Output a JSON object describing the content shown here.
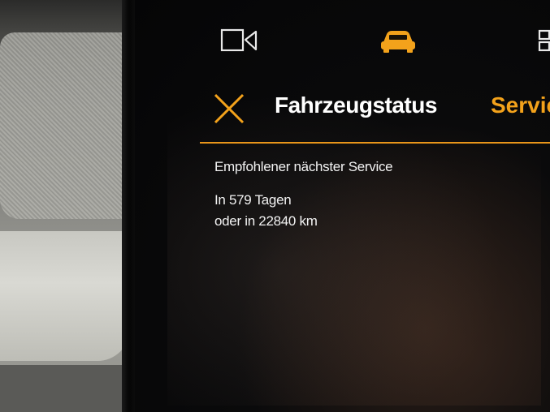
{
  "header": {
    "title": "Fahrzeugstatus",
    "active_tab": "Servic"
  },
  "service": {
    "label": "Empfohlener nächster Service",
    "days": "In 579 Tagen",
    "distance": "oder in 22840 km"
  },
  "colors": {
    "accent": "#f3a21b",
    "text": "#ffffff",
    "background": "#050506"
  },
  "icons": [
    "camera-icon",
    "car-icon",
    "grid-icon",
    "close-icon"
  ]
}
